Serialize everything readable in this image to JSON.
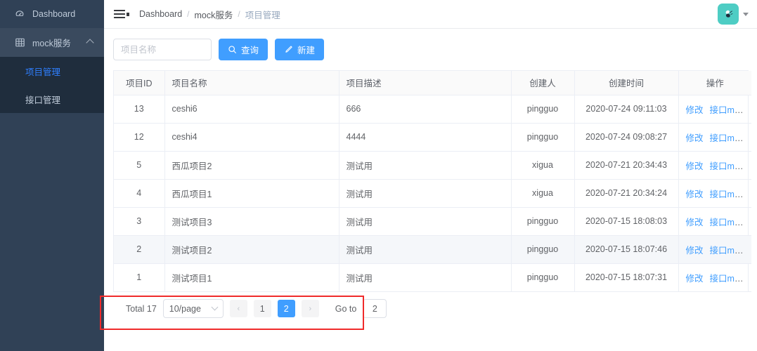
{
  "sidebar": {
    "items": [
      {
        "label": "Dashboard",
        "icon": "dashboard-icon"
      },
      {
        "label": "mock服务",
        "icon": "table-grid-icon",
        "expanded": true,
        "children": [
          {
            "label": "项目管理",
            "active": true
          },
          {
            "label": "接口管理",
            "active": false
          }
        ]
      }
    ]
  },
  "topbar": {
    "menu_icon": "hamburger-fold-icon",
    "breadcrumb": [
      {
        "label": "Dashboard"
      },
      {
        "label": "mock服务"
      },
      {
        "label": "项目管理"
      }
    ],
    "breadcrumb_separator": "/",
    "avatar": {
      "icon": "user-avatar-icon",
      "color": "#4ecdc4"
    },
    "avatar_caret": "chevron-down-icon"
  },
  "toolbar": {
    "search_placeholder": "项目名称",
    "search_value": "",
    "query_label": "查询",
    "query_icon": "search-icon",
    "create_label": "新建",
    "create_icon": "edit-pencil-icon"
  },
  "table": {
    "columns": [
      {
        "label": "项目ID",
        "align": "center"
      },
      {
        "label": "项目名称",
        "align": "left"
      },
      {
        "label": "项目描述",
        "align": "left"
      },
      {
        "label": "创建人",
        "align": "center"
      },
      {
        "label": "创建时间",
        "align": "center"
      },
      {
        "label": "操作",
        "align": "center"
      }
    ],
    "actions": {
      "edit": "修改",
      "mock": "接口mock"
    },
    "rows": [
      {
        "id": "13",
        "name": "ceshi6",
        "desc": "666",
        "creator": "pingguo",
        "created": "2020-07-24 09:11:03",
        "hovered": false
      },
      {
        "id": "12",
        "name": "ceshi4",
        "desc": "4444",
        "creator": "pingguo",
        "created": "2020-07-24 09:08:27",
        "hovered": false
      },
      {
        "id": "5",
        "name": "西瓜项目2",
        "desc": "测试用",
        "creator": "xigua",
        "created": "2020-07-21 20:34:43",
        "hovered": false
      },
      {
        "id": "4",
        "name": "西瓜项目1",
        "desc": "测试用",
        "creator": "xigua",
        "created": "2020-07-21 20:34:24",
        "hovered": false
      },
      {
        "id": "3",
        "name": "测试项目3",
        "desc": "测试用",
        "creator": "pingguo",
        "created": "2020-07-15 18:08:03",
        "hovered": false
      },
      {
        "id": "2",
        "name": "测试项目2",
        "desc": "测试用",
        "creator": "pingguo",
        "created": "2020-07-15 18:07:46",
        "hovered": true
      },
      {
        "id": "1",
        "name": "测试项目1",
        "desc": "测试用",
        "creator": "pingguo",
        "created": "2020-07-15 18:07:31",
        "hovered": false
      }
    ]
  },
  "pagination": {
    "total_label": "Total 17",
    "page_size": "10/page",
    "prev_icon": "chevron-left-icon",
    "next_icon": "chevron-right-icon",
    "pages": [
      {
        "label": "1",
        "active": false
      },
      {
        "label": "2",
        "active": true
      }
    ],
    "goto_label": "Go to",
    "goto_value": "2"
  },
  "annotation": {
    "color": "#f02b2b"
  }
}
